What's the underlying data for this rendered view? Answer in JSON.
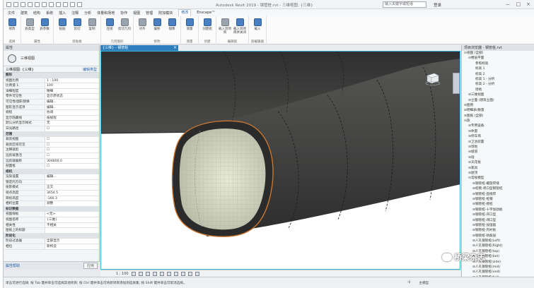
{
  "app": {
    "title": "Autodesk Revit 2019  -  钢管桩.rvt - 三维视图: {三维}",
    "search_placeholder": "输入关键字或短语",
    "user_label": "登录",
    "window_controls": [
      "－",
      "□",
      "×"
    ]
  },
  "menu": {
    "tabs": [
      "文件",
      "建筑",
      "结构",
      "系统",
      "插入",
      "注释",
      "分析",
      "体量和场地",
      "协作",
      "视图",
      "管理",
      "附加模块",
      "修改",
      "Enscape™"
    ],
    "active_index": 12
  },
  "ribbon": {
    "groups": [
      {
        "label": "选择",
        "buttons": [
          "修改"
        ]
      },
      {
        "label": "属性",
        "buttons": [
          "族类型",
          "族参数"
        ]
      },
      {
        "label": "剪贴板",
        "buttons": [
          "粘贴",
          "剪切",
          "复制"
        ]
      },
      {
        "label": "几何图形",
        "buttons": [
          "连接",
          "剪切几何"
        ]
      },
      {
        "label": "修改",
        "buttons": [
          "对齐",
          "偏移",
          "镜像"
        ]
      },
      {
        "label": "测量",
        "buttons": [
          "测量"
        ]
      },
      {
        "label": "创建",
        "buttons": [
          "创建组"
        ]
      },
      {
        "label": "编辑族",
        "buttons": [
          "载入到项目",
          "载入到项目并关闭"
        ]
      },
      {
        "label": "族编辑器",
        "buttons": [
          "载入"
        ]
      }
    ]
  },
  "properties": {
    "header": "属性",
    "type_name": "三维视图",
    "family_selector": "三维视图: {三维}",
    "edit_type": "编辑类型",
    "rows": [
      {
        "k": "图形",
        "v": "",
        "sec": true
      },
      {
        "k": "视图比例",
        "v": "1 : 100"
      },
      {
        "k": "比例值 1:",
        "v": "100"
      },
      {
        "k": "详细程度",
        "v": "精细"
      },
      {
        "k": "零件可见性",
        "v": "显示原状态"
      },
      {
        "k": "可见性/图形替换",
        "v": "编辑..."
      },
      {
        "k": "图形显示选项",
        "v": "编辑..."
      },
      {
        "k": "规程",
        "v": "协调"
      },
      {
        "k": "显示隐藏线",
        "v": "按规程"
      },
      {
        "k": "默认分析显示样式",
        "v": "无"
      },
      {
        "k": "日光路径",
        "v": "☐"
      },
      {
        "k": "范围",
        "v": "",
        "sec": true
      },
      {
        "k": "裁剪视图",
        "v": "☐"
      },
      {
        "k": "裁剪区域可见",
        "v": "☐"
      },
      {
        "k": "注释裁剪",
        "v": "☐"
      },
      {
        "k": "远剪裁激活",
        "v": "☐"
      },
      {
        "k": "远剪裁偏移",
        "v": "304800.0"
      },
      {
        "k": "剖面框",
        "v": "☐"
      },
      {
        "k": "相机",
        "v": "",
        "sec": true
      },
      {
        "k": "渲染设置",
        "v": "编辑..."
      },
      {
        "k": "锁定的方向",
        "v": ""
      },
      {
        "k": "投影模式",
        "v": "正交"
      },
      {
        "k": "视点高度",
        "v": "3654.5"
      },
      {
        "k": "目标高度",
        "v": "-166.3"
      },
      {
        "k": "相机位置",
        "v": "调整"
      },
      {
        "k": "标识数据",
        "v": "",
        "sec": true
      },
      {
        "k": "视图样板",
        "v": "<无>"
      },
      {
        "k": "视图名称",
        "v": "{三维}"
      },
      {
        "k": "相关性",
        "v": "不相关"
      },
      {
        "k": "图纸上的标题",
        "v": ""
      },
      {
        "k": "阶段化",
        "v": "",
        "sec": true
      },
      {
        "k": "阶段过滤器",
        "v": "全部显示"
      },
      {
        "k": "相位",
        "v": "新构造"
      }
    ],
    "help_link": "属性帮助",
    "apply": "应用"
  },
  "view": {
    "tab_label": "{三维} - 钢管桩",
    "scale": "1 : 100"
  },
  "browser": {
    "header": "项目浏览器 - 钢管桩.rvt",
    "nodes": [
      {
        "t": "视图 (全部)",
        "lvl": 0,
        "tg": "⊟"
      },
      {
        "t": "楼层平面",
        "lvl": 1,
        "tg": "⊟"
      },
      {
        "t": "参照标高",
        "lvl": 2,
        "tg": ""
      },
      {
        "t": "标高 1",
        "lvl": 2,
        "tg": ""
      },
      {
        "t": "标高 2",
        "lvl": 2,
        "tg": ""
      },
      {
        "t": "标高 1 - 分析",
        "lvl": 2,
        "tg": ""
      },
      {
        "t": "标高 2 - 分析",
        "lvl": 2,
        "tg": ""
      },
      {
        "t": "场地",
        "lvl": 2,
        "tg": ""
      },
      {
        "t": "三维视图",
        "lvl": 1,
        "tg": "⊞"
      },
      {
        "t": "立面 (建筑立面)",
        "lvl": 1,
        "tg": "⊞"
      },
      {
        "t": "图例",
        "lvl": 0,
        "tg": "⊞"
      },
      {
        "t": "明细表/数量",
        "lvl": 0,
        "tg": "⊞"
      },
      {
        "t": "图纸 (全部)",
        "lvl": 0,
        "tg": "⊞"
      },
      {
        "t": "族",
        "lvl": 0,
        "tg": "⊟"
      },
      {
        "t": "专用设备",
        "lvl": 1,
        "tg": "⊞"
      },
      {
        "t": "体量",
        "lvl": 1,
        "tg": "⊞"
      },
      {
        "t": "停车场",
        "lvl": 1,
        "tg": "⊞"
      },
      {
        "t": "卫浴装置",
        "lvl": 1,
        "tg": "⊞"
      },
      {
        "t": "场地",
        "lvl": 1,
        "tg": "⊞"
      },
      {
        "t": "坡道",
        "lvl": 1,
        "tg": "⊞"
      },
      {
        "t": "墙",
        "lvl": 1,
        "tg": "⊞"
      },
      {
        "t": "天花板",
        "lvl": 1,
        "tg": "⊞"
      },
      {
        "t": "家具",
        "lvl": 1,
        "tg": "⊞"
      },
      {
        "t": "屋顶",
        "lvl": 1,
        "tg": "⊞"
      },
      {
        "t": "常规模型",
        "lvl": 1,
        "tg": "⊟"
      },
      {
        "t": "钢管桩-螺旋焊缝",
        "lvl": 2,
        "tg": "⊞"
      },
      {
        "t": "桩靴-闭口型钢管桩",
        "lvl": 2,
        "tg": "⊞"
      },
      {
        "t": "钢管桩-直缝焊",
        "lvl": 2,
        "tg": "⊞"
      },
      {
        "t": "钢管桩-桩帽",
        "lvl": 2,
        "tg": "⊞"
      },
      {
        "t": "钢管桩-接桩",
        "lvl": 2,
        "tg": "⊞"
      },
      {
        "t": "钢管桩-十字加劲板",
        "lvl": 2,
        "tg": "⊞"
      },
      {
        "t": "钢管桩-开口型",
        "lvl": 2,
        "tg": "⊞"
      },
      {
        "t": "钢管桩-闭口型",
        "lvl": 2,
        "tg": "⊞"
      },
      {
        "t": "钢管桩-加强箍",
        "lvl": 2,
        "tg": "⊞"
      },
      {
        "t": "钢管桩-内衬板",
        "lvl": 2,
        "tg": "⊞"
      },
      {
        "t": "钢管桩-防腐层",
        "lvl": 2,
        "tg": "⊞"
      },
      {
        "t": "人孔钢管桩(Left)",
        "lvl": 2,
        "tg": "⊞"
      },
      {
        "t": "人孔钢管桩(Right)",
        "lvl": 2,
        "tg": "⊞"
      },
      {
        "t": "人孔钢管桩(top)",
        "lvl": 2,
        "tg": "⊞"
      },
      {
        "t": "人孔钢管桩(bot)",
        "lvl": 2,
        "tg": "⊞"
      },
      {
        "t": "人孔钢管桩(side)",
        "lvl": 2,
        "tg": "⊞"
      },
      {
        "t": "人孔钢管桩(mid)",
        "lvl": 2,
        "tg": "⊞"
      },
      {
        "t": "人孔钢管桩(end)",
        "lvl": 2,
        "tg": "⊞"
      },
      {
        "t": "人孔钢管桩(full)",
        "lvl": 2,
        "tg": "⊞"
      }
    ]
  },
  "status": {
    "text": "单击可进行选择; 按 Tab 键并单击可选择其他项目; 按 Ctrl 键并单击可将新项目添加到选择集; 按 Shift 键并单击可取消选择。",
    "model": "主模型",
    "zoom": ":0"
  },
  "watermark": {
    "text": "桥梁杂志"
  },
  "colors": {
    "accent": "#2e7fbd",
    "viewport_border": "#3bb8d6",
    "pipe_dark": "#3f3f3e",
    "pipe_inner": "#d8dcc7",
    "weld_line": "#c9752f"
  }
}
